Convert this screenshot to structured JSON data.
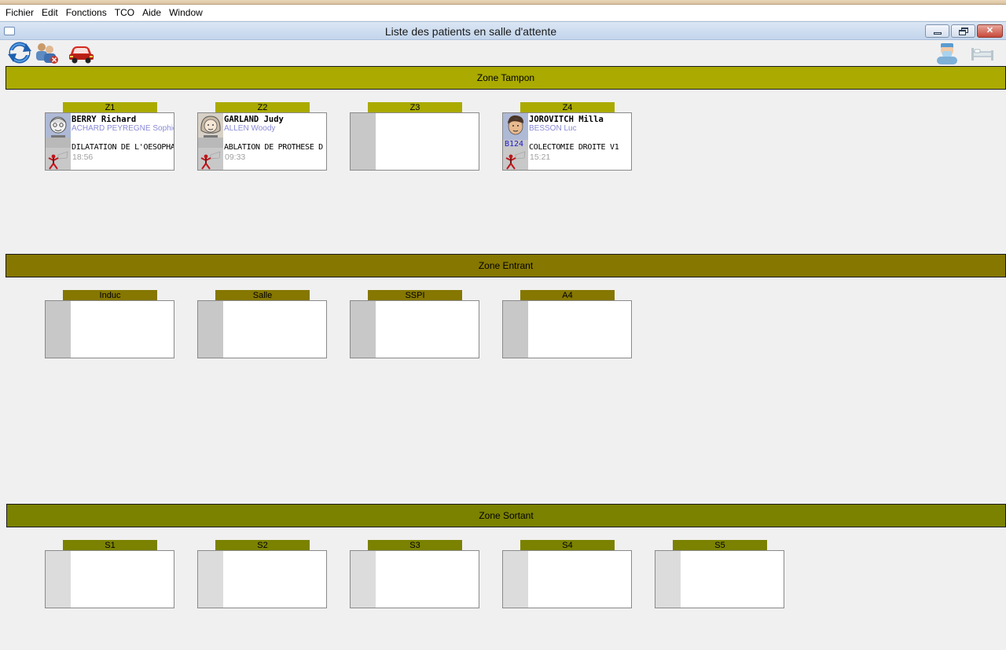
{
  "menu": [
    "Fichier",
    "Edit",
    "Fonctions",
    "TCO",
    "Aide",
    "Window"
  ],
  "window": {
    "title": "Liste des patients en salle d'attente",
    "close_glyph": "✕"
  },
  "toolbar": {
    "left": [
      "refresh-icon",
      "patient-users-icon",
      "transport-car-icon"
    ],
    "right": [
      "surgeon-icon",
      "bed-icon"
    ]
  },
  "colors": {
    "zone_tampon": "#aaaa00",
    "zone_entrant": "#857700",
    "zone_sortant": "#7b8200",
    "doctor_text": "#8a8ad8",
    "room_code": "#1b1bd0"
  },
  "zones": {
    "tampon": {
      "title": "Zone Tampon",
      "slots": [
        {
          "label": "Z1",
          "patient": {
            "name": "BERRY Richard",
            "doctor": "ACHARD PEYREGNE Sophie",
            "procedure": "DILATATION DE L'OESOPHA",
            "time": "18:56",
            "room": ""
          }
        },
        {
          "label": "Z2",
          "patient": {
            "name": "GARLAND Judy",
            "doctor": "ALLEN Woody",
            "procedure": "ABLATION DE PROTHESE D",
            "time": "09:33",
            "room": ""
          }
        },
        {
          "label": "Z3"
        },
        {
          "label": "Z4",
          "patient": {
            "name": "JOROVITCH Milla",
            "doctor": "BESSON Luc",
            "procedure": "COLECTOMIE DROITE V1",
            "time": "15:21",
            "room": "B124"
          }
        }
      ]
    },
    "entrant": {
      "title": "Zone Entrant",
      "slots": [
        {
          "label": "Induc"
        },
        {
          "label": "Salle"
        },
        {
          "label": "SSPI"
        },
        {
          "label": "A4"
        }
      ]
    },
    "sortant": {
      "title": "Zone Sortant",
      "slots": [
        {
          "label": "S1"
        },
        {
          "label": "S2"
        },
        {
          "label": "S3"
        },
        {
          "label": "S4"
        },
        {
          "label": "S5"
        }
      ]
    }
  }
}
